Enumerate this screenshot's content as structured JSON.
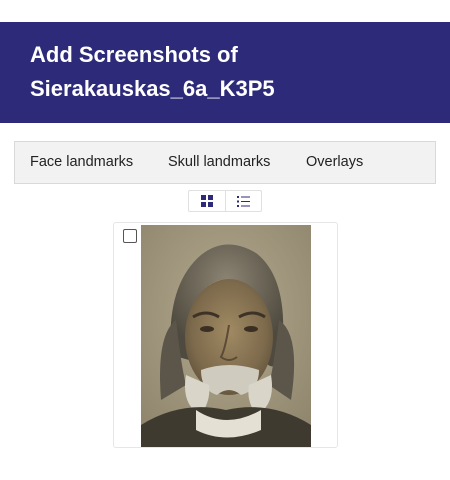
{
  "header": {
    "title_line1": "Add Screenshots of",
    "title_line2": "Sierakauskas_6a_K3P5"
  },
  "tabs": [
    {
      "label": "Face landmarks"
    },
    {
      "label": "Skull landmarks"
    },
    {
      "label": "Overlays"
    }
  ],
  "view_toggle": {
    "grid_icon": "grid-view-icon",
    "list_icon": "list-view-icon"
  },
  "screenshot_card": {
    "checked": false,
    "image_subject": "portrait-photo"
  },
  "colors": {
    "header_bg": "#2d2a7a",
    "tabbar_bg": "#f2f2f2",
    "icon_color": "#2d2a7a"
  }
}
